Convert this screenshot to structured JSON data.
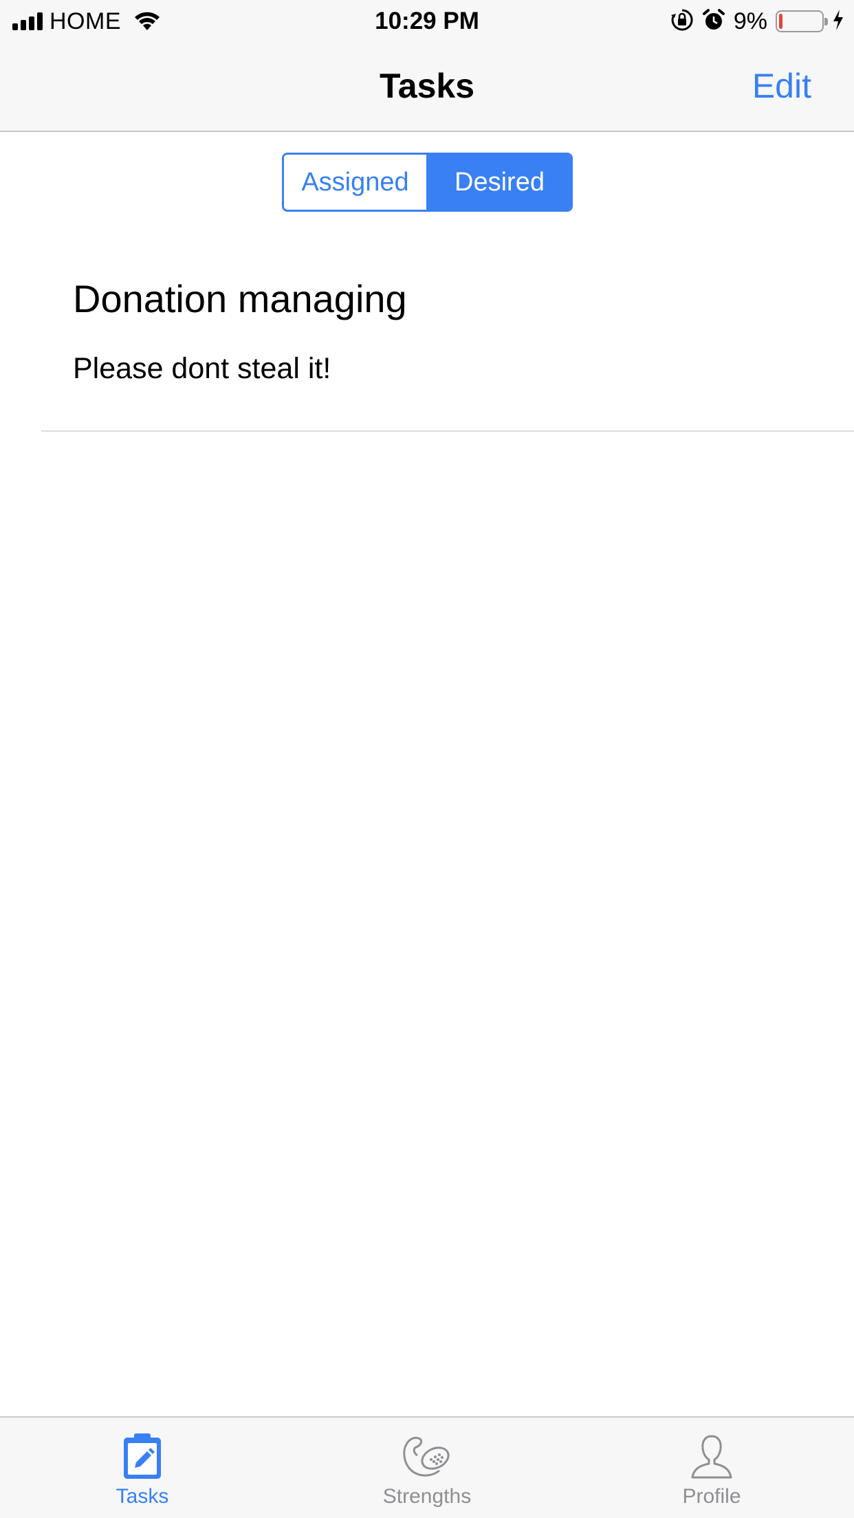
{
  "status_bar": {
    "carrier": "HOME",
    "time": "10:29 PM",
    "battery_percent": "9%",
    "battery_level": 0.09,
    "icons": [
      "signal-icon",
      "wifi-icon",
      "orientation-lock-icon",
      "alarm-icon",
      "battery-icon",
      "charging-icon"
    ]
  },
  "nav": {
    "title": "Tasks",
    "edit_label": "Edit"
  },
  "segmented": {
    "options": [
      "Assigned",
      "Desired"
    ],
    "selected": "Desired"
  },
  "tasks": [
    {
      "title": "Donation managing",
      "description": "Please dont steal it!"
    }
  ],
  "tab_bar": {
    "tabs": [
      {
        "label": "Tasks",
        "icon": "clipboard-edit-icon",
        "selected": true
      },
      {
        "label": "Strengths",
        "icon": "strengths-icon",
        "selected": false
      },
      {
        "label": "Profile",
        "icon": "person-icon",
        "selected": false
      }
    ]
  },
  "colors": {
    "accent": "#3880f3",
    "inactive_tab": "#8e8e93",
    "battery_low": "#e5443a",
    "bar_background": "#f7f7f7"
  }
}
